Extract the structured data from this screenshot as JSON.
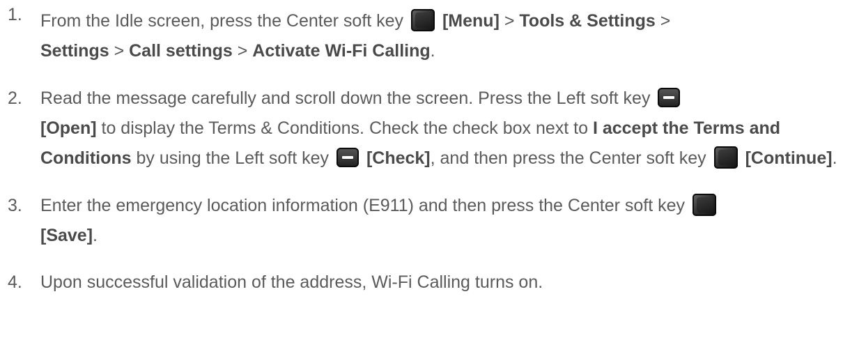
{
  "steps": [
    {
      "number": "1.",
      "line1_text_a": "From the Idle screen, press the Center soft key ",
      "menu_label": "[Menu]",
      "sep1": " > ",
      "tools_settings": "Tools & Settings",
      "sep2": " >",
      "settings": "Settings",
      "sep3": " > ",
      "call_settings": "Call settings",
      "sep4": " > ",
      "activate": "Activate Wi-Fi Calling",
      "end": "."
    },
    {
      "number": "2.",
      "text_a": "Read the message carefully and scroll down the screen. Press the Left soft key ",
      "open_label": "[Open]",
      "text_b": " to display the Terms & Conditions. Check the check box next to ",
      "accept_label": "I accept the Terms and Conditions",
      "text_c": " by using the Left soft key ",
      "check_label": "[Check]",
      "text_d": ", and then press the Center soft key ",
      "continue_label": "[Continue]",
      "end": "."
    },
    {
      "number": "3.",
      "text_a": "Enter the emergency location information (E911) and then press the Center soft key ",
      "save_label": "[Save]",
      "end": "."
    },
    {
      "number": "4.",
      "text_a": "Upon successful validation of the address, Wi-Fi Calling turns on."
    }
  ],
  "icons": {
    "center_key": "center-soft-key-icon",
    "left_key": "left-soft-key-icon"
  }
}
